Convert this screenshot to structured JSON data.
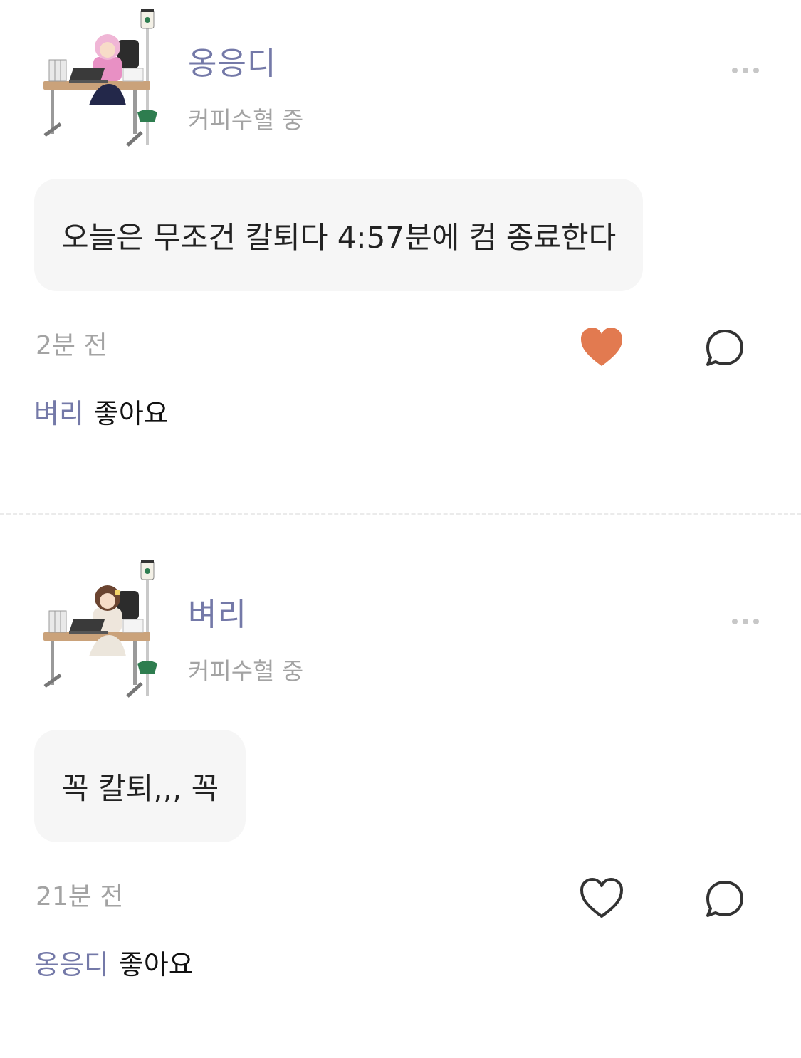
{
  "comments": [
    {
      "author": "옹응디",
      "status": "커피수혈 중",
      "message": "오늘은 무조건 칼퇴다 4:57분에 컴 종료한다",
      "time": "2분 전",
      "liked": true,
      "likes_by": "벼리",
      "likes_suffix": "좋아요"
    },
    {
      "author": "벼리",
      "status": "커피수혈 중",
      "message": "꼭 칼퇴,,, 꼭",
      "time": "21분 전",
      "liked": false,
      "likes_by": "옹응디",
      "likes_suffix": "좋아요"
    }
  ],
  "icons": {
    "more": "more-horizontal-icon",
    "like": "heart-icon",
    "comment": "comment-bubble-icon"
  },
  "colors": {
    "author": "#7479a8",
    "muted": "#a3a3a3",
    "heart_filled": "#e27a50",
    "bubble": "#f6f6f6"
  }
}
